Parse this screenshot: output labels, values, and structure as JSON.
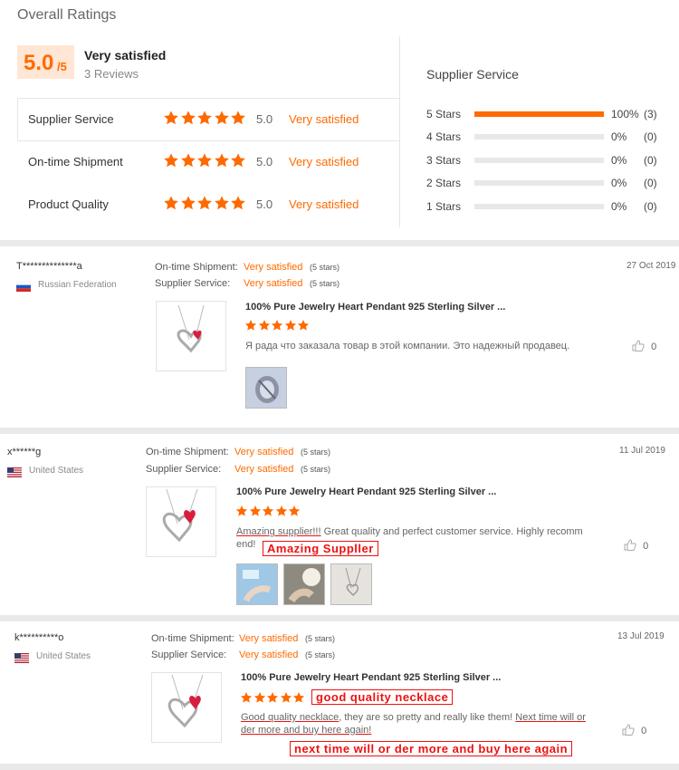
{
  "overall": {
    "title": "Overall Ratings",
    "score": "5.0",
    "score_max": "/5",
    "satisfaction": "Very satisfied",
    "reviews": "3 Reviews",
    "categories": [
      {
        "label": "Supplier Service",
        "score": "5.0",
        "text": "Very satisfied",
        "stars": 5
      },
      {
        "label": "On-time Shipment",
        "score": "5.0",
        "text": "Very satisfied",
        "stars": 5
      },
      {
        "label": "Product Quality",
        "score": "5.0",
        "text": "Very satisfied",
        "stars": 5
      }
    ]
  },
  "supplier_service": {
    "title": "Supplier Service",
    "rows": [
      {
        "label": "5 Stars",
        "percent": 100,
        "pct_text": "100%",
        "count": "(3)"
      },
      {
        "label": "4 Stars",
        "percent": 0,
        "pct_text": "0%",
        "count": "(0)"
      },
      {
        "label": "3 Stars",
        "percent": 0,
        "pct_text": "0%",
        "count": "(0)"
      },
      {
        "label": "2 Stars",
        "percent": 0,
        "pct_text": "0%",
        "count": "(0)"
      },
      {
        "label": "1 Stars",
        "percent": 0,
        "pct_text": "0%",
        "count": "(0)"
      }
    ]
  },
  "colors": {
    "accent": "#ff6a00",
    "annotation": "#ee1111"
  },
  "reviews": [
    {
      "user": "T**************a",
      "country": "Russian Federation",
      "flag": "ru-flag-icon",
      "date": "27 Oct 2019",
      "shipment_label": "On-time Shipment:",
      "shipment_value": "Very satisfied",
      "shipment_stars": "(5 stars)",
      "service_label": "Supplier Service:",
      "service_value": "Very satisfied",
      "service_stars": "(5 stars)",
      "product": "100% Pure Jewelry Heart Pendant 925 Sterling Silver ...",
      "rating": 5,
      "text": "Я рада что заказала товар в этой компании. Это надежный продавец.",
      "likes": "0"
    },
    {
      "user": "x******g",
      "country": "United States",
      "flag": "us-flag-icon",
      "date": "11 Jul 2019",
      "shipment_label": "On-time Shipment:",
      "shipment_value": "Very satisfied",
      "shipment_stars": "(5 stars)",
      "service_label": "Supplier Service:",
      "service_value": "Very satisfied",
      "service_stars": "(5 stars)",
      "product": "100% Pure Jewelry Heart Pendant 925 Sterling Silver ...",
      "rating": 5,
      "text_a": "Amazing supplier!!!",
      "text_b": " Great quality and perfect customer service. Highly recomm",
      "text_c": "end!",
      "annotation": "Amazing Suppller",
      "likes": "0"
    },
    {
      "user": "k**********o",
      "country": "United States",
      "flag": "us-flag-icon",
      "date": "13 Jul 2019",
      "shipment_label": "On-time Shipment:",
      "shipment_value": "Very satisfied",
      "shipment_stars": "(5 stars)",
      "service_label": "Supplier Service:",
      "service_value": "Very satisfied",
      "service_stars": "(5 stars)",
      "product": "100% Pure Jewelry Heart Pendant 925 Sterling Silver ...",
      "rating": 5,
      "text_a": "Good quality necklace",
      "text_b": ", they are so pretty and really like them! ",
      "text_c": "Next time will or",
      "text_d": "der more and buy here again!",
      "annotation1": "good quality necklace",
      "annotation2": "next time will or der more and buy here again",
      "likes": "0"
    }
  ]
}
